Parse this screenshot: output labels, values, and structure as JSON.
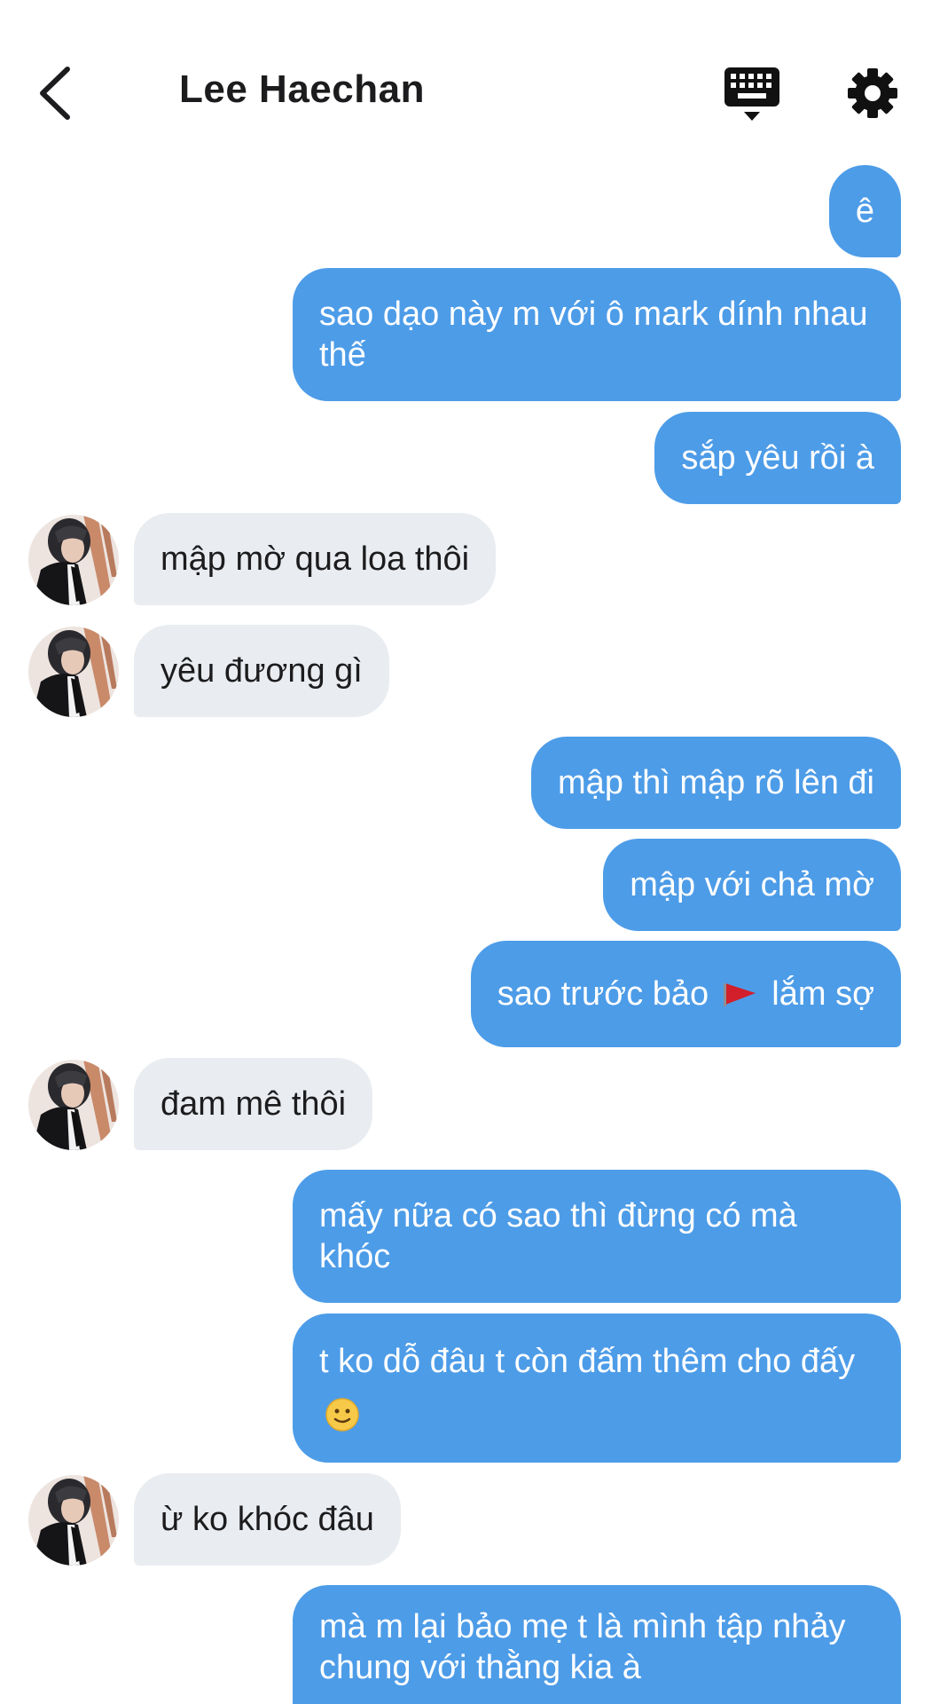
{
  "header": {
    "title": "Lee Haechan",
    "back_icon": "chevron-left-icon",
    "keyboard_icon": "keyboard-icon",
    "settings_icon": "gear-icon"
  },
  "colors": {
    "outgoing_bubble": "#4d9ce8",
    "incoming_bubble": "#e9ecf0",
    "outgoing_text": "#ffffff",
    "incoming_text": "#1c1c1e"
  },
  "messages": [
    {
      "sender": "me",
      "text": "ê"
    },
    {
      "sender": "me",
      "text": "sao dạo này m với ô mark dính nhau thế"
    },
    {
      "sender": "me",
      "text": "sắp yêu rồi à"
    },
    {
      "sender": "Lee Haechan",
      "text": "mập mờ qua loa thôi"
    },
    {
      "sender": "Lee Haechan",
      "text": "yêu đương gì"
    },
    {
      "sender": "me",
      "text": "mập thì mập rõ lên đi"
    },
    {
      "sender": "me",
      "text": "mập với chả mờ"
    },
    {
      "sender": "me",
      "text_before": "sao trước bảo",
      "emoji": "red-flag-icon",
      "text_after": "lắm sợ"
    },
    {
      "sender": "Lee Haechan",
      "text": "đam mê thôi"
    },
    {
      "sender": "me",
      "text": "mấy nữa có sao thì đừng có mà khóc"
    },
    {
      "sender": "me",
      "text_before": "t ko dỗ đâu t còn đấm thêm cho đấy",
      "emoji": "slightly-smiling-face-icon"
    },
    {
      "sender": "Lee Haechan",
      "text": "ừ ko khóc đâu"
    },
    {
      "sender": "me",
      "text": "mà m lại bảo mẹ t là mình tập nhảy chung với thằng kia à"
    }
  ]
}
